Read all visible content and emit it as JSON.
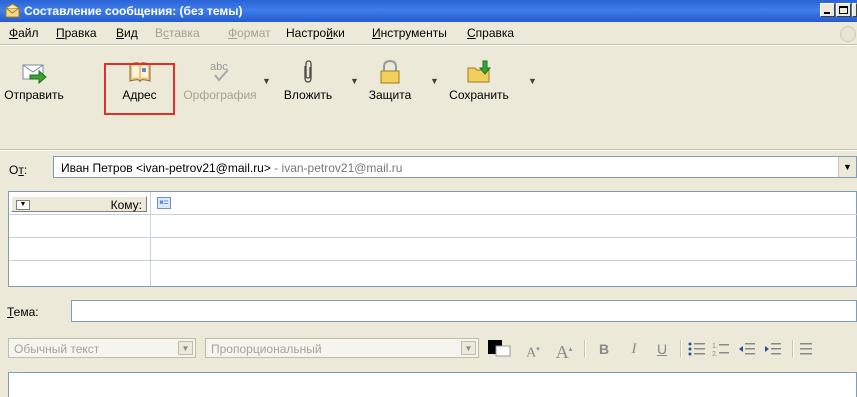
{
  "window": {
    "title": "Составление сообщения: (без темы)"
  },
  "menu": [
    {
      "label": "Файл",
      "u": "Ф",
      "rest": "айл",
      "disabled": false
    },
    {
      "label": "Правка",
      "u": "П",
      "rest": "равка",
      "disabled": false
    },
    {
      "label": "Вид",
      "u": "В",
      "rest": "ид",
      "disabled": false
    },
    {
      "label": "Вставка",
      "pre": "В",
      "u": "с",
      "rest": "тавка",
      "disabled": true
    },
    {
      "label": "Формат",
      "u": "Ф",
      "rest": "ормат",
      "disabled": true
    },
    {
      "label": "Настройки",
      "pre": "Настро",
      "u": "й",
      "rest": "ки",
      "disabled": false
    },
    {
      "label": "Инструменты",
      "u": "И",
      "rest": "нструменты",
      "disabled": false
    },
    {
      "label": "Справка",
      "u": "С",
      "rest": "правка",
      "disabled": false
    }
  ],
  "toolbar": {
    "send": "Отправить",
    "address": "Адрес",
    "spell": "Орфография",
    "spell_icon_text": "abc",
    "attach": "Вложить",
    "security": "Защита",
    "save": "Сохранить",
    "highlighted": "Адрес"
  },
  "from": {
    "label_pre": "О",
    "label_u": "т",
    "label_post": ":",
    "name": "Иван Петров <ivan-petrov21@mail.ru>",
    "account": " - ivan-petrov21@mail.ru"
  },
  "recipients": {
    "type_label": "Кому:",
    "rows": 4
  },
  "subject": {
    "label_u": "Т",
    "label_rest": "ема:",
    "value": ""
  },
  "format": {
    "paragraph": "Обычный текст",
    "font": "Пропорциональный",
    "bold": "B",
    "italic": "I",
    "underline": "U",
    "decrease": "A",
    "increase": "A",
    "numbered_icon_text": "1."
  },
  "colors": {
    "titlebar": "#2a63d6",
    "highlight": "#e0302a",
    "disabled": "#a7a393"
  }
}
